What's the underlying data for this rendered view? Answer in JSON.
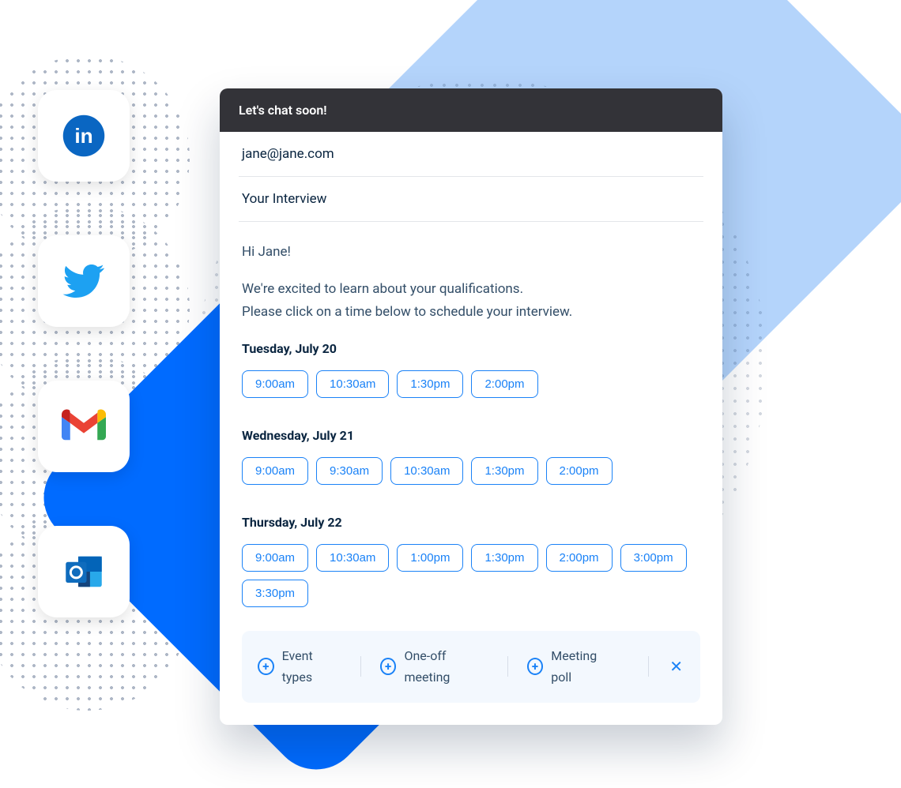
{
  "icons": [
    "linkedin-icon",
    "twitter-icon",
    "gmail-icon",
    "outlook-icon"
  ],
  "card": {
    "title": "Let's chat soon!",
    "to": "jane@jane.com",
    "subject": "Your Interview",
    "greeting": "Hi Jane!",
    "body_line1": "We're excited to learn about your qualifications.",
    "body_line2": "Please click on a time below to schedule your interview.",
    "days": [
      {
        "label": "Tuesday, July 20",
        "slots": [
          "9:00am",
          "10:30am",
          "1:30pm",
          "2:00pm"
        ]
      },
      {
        "label": "Wednesday, July 21",
        "slots": [
          "9:00am",
          "9:30am",
          "10:30am",
          "1:30pm",
          "2:00pm"
        ]
      },
      {
        "label": "Thursday, July 22",
        "slots": [
          "9:00am",
          "10:30am",
          "1:00pm",
          "1:30pm",
          "2:00pm",
          "3:00pm",
          "3:30pm"
        ]
      }
    ],
    "footer": {
      "event_types": "Event types",
      "one_off": "One-off meeting",
      "poll": "Meeting poll"
    }
  }
}
